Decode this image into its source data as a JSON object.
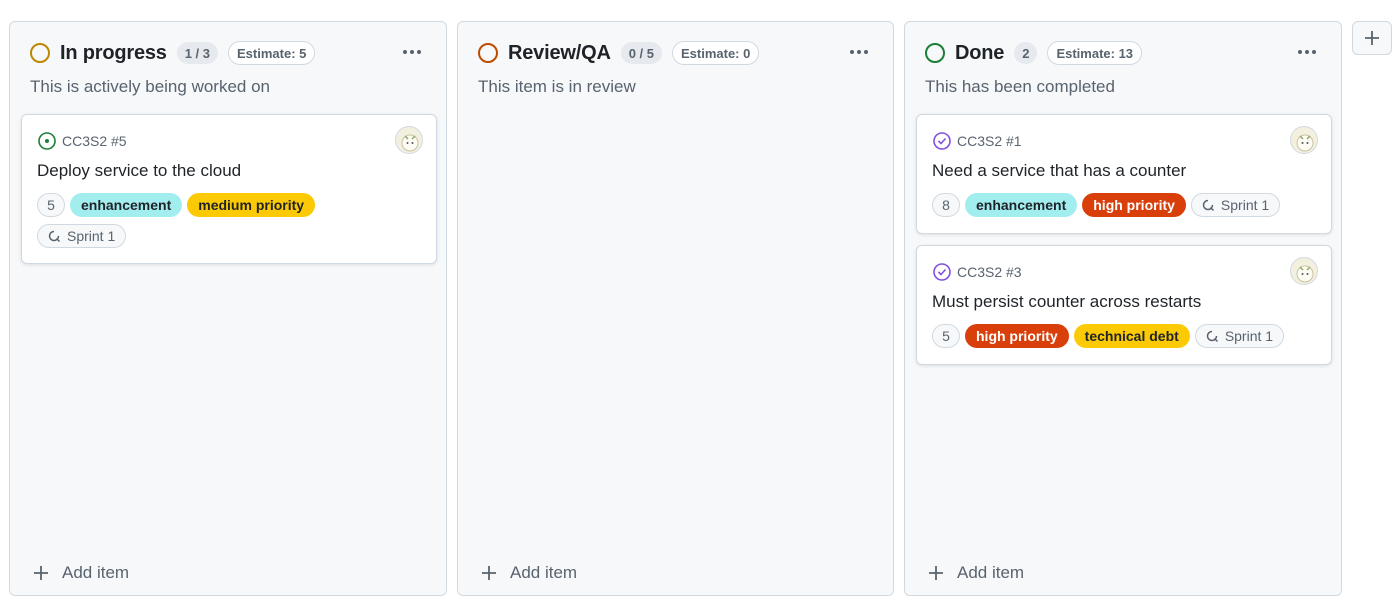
{
  "colors": {
    "in_progress": "#bf8700",
    "review": "#bc4c00",
    "done": "#1a7f37",
    "open_issue": "#1a7f37",
    "closed_issue": "#8250df"
  },
  "columns": [
    {
      "title": "In progress",
      "count": "1 / 3",
      "estimate": "Estimate: 5",
      "description": "This is actively being worked on",
      "add_item": "Add item",
      "cards": [
        {
          "ref": "CC3S2 #5",
          "state_icon": "issue-opened-icon",
          "title": "Deploy service to the cloud",
          "number": "5",
          "labels": [
            {
              "text": "enhancement",
              "bg": "#a2eeef",
              "fg": "#1f2328"
            },
            {
              "text": "medium priority",
              "bg": "#fbca04",
              "fg": "#1f2328"
            }
          ],
          "sprint": "Sprint 1"
        }
      ]
    },
    {
      "title": "Review/QA",
      "count": "0 / 5",
      "estimate": "Estimate: 0",
      "description": "This item is in review",
      "add_item": "Add item",
      "cards": []
    },
    {
      "title": "Done",
      "count": "2",
      "estimate": "Estimate: 13",
      "description": "This has been completed",
      "add_item": "Add item",
      "cards": [
        {
          "ref": "CC3S2 #1",
          "state_icon": "issue-closed-icon",
          "title": "Need a service that has a counter",
          "number": "8",
          "labels": [
            {
              "text": "enhancement",
              "bg": "#a2eeef",
              "fg": "#1f2328"
            },
            {
              "text": "high priority",
              "bg": "#d93f0b",
              "fg": "#ffffff"
            }
          ],
          "sprint": "Sprint 1"
        },
        {
          "ref": "CC3S2 #3",
          "state_icon": "issue-closed-icon",
          "title": "Must persist counter across restarts",
          "number": "5",
          "labels": [
            {
              "text": "high priority",
              "bg": "#d93f0b",
              "fg": "#ffffff"
            },
            {
              "text": "technical debt",
              "bg": "#fbca04",
              "fg": "#1f2328"
            }
          ],
          "sprint": "Sprint 1"
        }
      ]
    }
  ]
}
